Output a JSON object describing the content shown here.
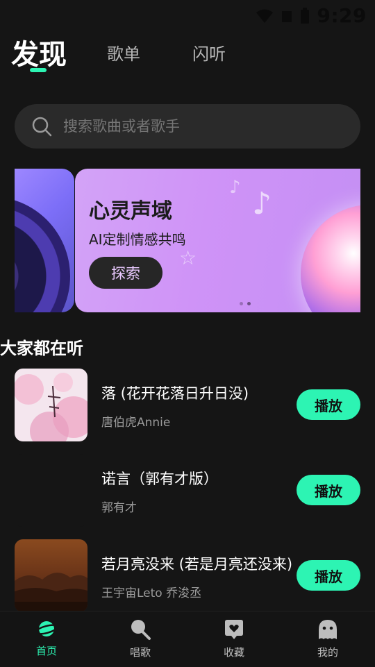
{
  "status_bar": {
    "time": "9:29"
  },
  "tabs": [
    {
      "label": "发现",
      "active": true
    },
    {
      "label": "歌单",
      "active": false
    },
    {
      "label": "闪听",
      "active": false
    }
  ],
  "search": {
    "placeholder": "搜索歌曲或者歌手"
  },
  "banner": {
    "title": "心灵声域",
    "subtitle": "AI定制情感共鸣",
    "button_label": "探索",
    "page_count": 2,
    "active_page": 2
  },
  "section": {
    "title": "大家都在听"
  },
  "songs": [
    {
      "title": "落 (花开花落日升日没)",
      "artist": "唐伯虎Annie",
      "play_label": "播放"
    },
    {
      "title": "诺言（郭有才版）",
      "artist": "郭有才",
      "play_label": "播放"
    },
    {
      "title": "若月亮没来 (若是月亮还没来)",
      "artist": "王宇宙Leto 乔浚丞",
      "play_label": "播放"
    }
  ],
  "bottom_nav": [
    {
      "label": "首页",
      "icon": "planet-icon",
      "active": true
    },
    {
      "label": "唱歌",
      "icon": "microphone-icon",
      "active": false
    },
    {
      "label": "收藏",
      "icon": "heart-box-icon",
      "active": false
    },
    {
      "label": "我的",
      "icon": "ghost-icon",
      "active": false
    }
  ],
  "colors": {
    "accent": "#2df4b3",
    "background": "#151515",
    "banner": "#cf93f7"
  }
}
